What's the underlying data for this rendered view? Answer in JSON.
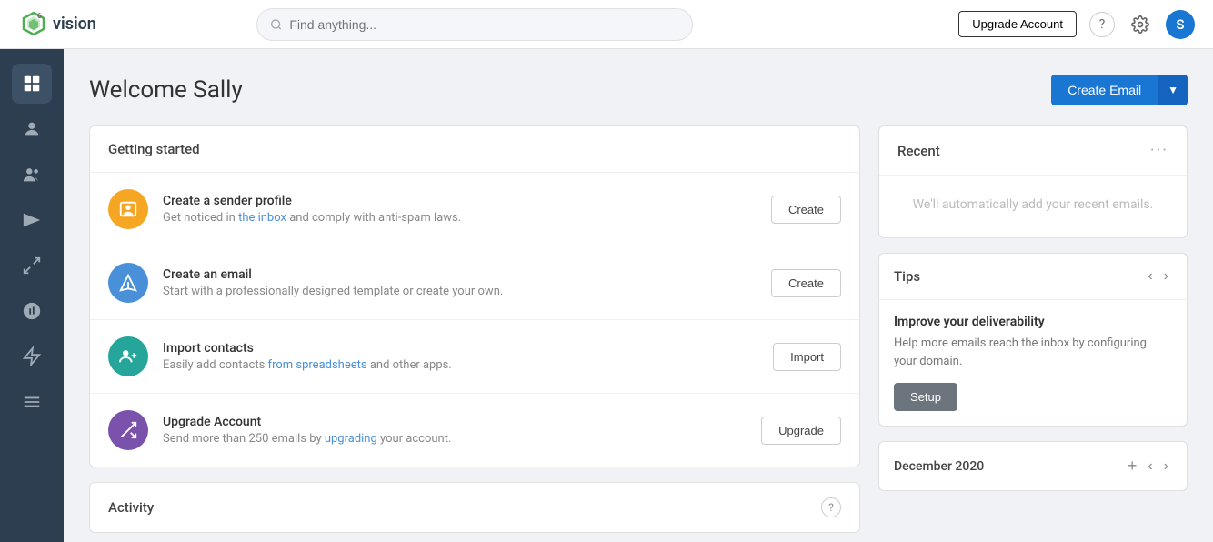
{
  "topnav": {
    "logo_text": "vision",
    "logo_superscript": "6",
    "search_placeholder": "Find anything...",
    "upgrade_btn_label": "Upgrade Account",
    "help_icon": "?",
    "user_initial": "S"
  },
  "sidebar": {
    "items": [
      {
        "id": "dashboard",
        "label": "Dashboard",
        "active": true
      },
      {
        "id": "contacts-single",
        "label": "Profile"
      },
      {
        "id": "contacts",
        "label": "Contacts"
      },
      {
        "id": "campaigns",
        "label": "Campaigns"
      },
      {
        "id": "split",
        "label": "Split"
      },
      {
        "id": "reports",
        "label": "Reports"
      },
      {
        "id": "automations",
        "label": "Automations"
      },
      {
        "id": "files",
        "label": "Files"
      }
    ]
  },
  "main": {
    "page_title": "Welcome Sally",
    "create_email_label": "Create Email",
    "create_email_dropdown_label": "▼"
  },
  "getting_started": {
    "title": "Getting started",
    "tasks": [
      {
        "id": "sender-profile",
        "title": "Create a sender profile",
        "desc_plain": "Get noticed in ",
        "desc_link": "the inbox",
        "desc_rest": " and comply with anti-spam laws.",
        "icon_color": "orange",
        "btn_label": "Create"
      },
      {
        "id": "create-email",
        "title": "Create an email",
        "desc": "Start with a professionally designed template or create your own.",
        "icon_color": "blue",
        "btn_label": "Create"
      },
      {
        "id": "import-contacts",
        "title": "Import contacts",
        "desc_plain": "Easily add contacts ",
        "desc_link": "from spreadsheets",
        "desc_rest": " and other apps.",
        "icon_color": "teal",
        "btn_label": "Import"
      },
      {
        "id": "upgrade-account",
        "title": "Upgrade Account",
        "desc_plain": "Send more than 250 emails by ",
        "desc_link": "upgrading",
        "desc_rest": " your account.",
        "icon_color": "purple",
        "btn_label": "Upgrade"
      }
    ]
  },
  "activity": {
    "title": "Activity"
  },
  "recent": {
    "title": "Recent",
    "empty_text": "We'll automatically add your recent emails.",
    "more_icon": "..."
  },
  "tips": {
    "title": "Tips",
    "card_title": "Improve your deliverability",
    "card_desc_part1": "Help more emails reach the inbox by configuring",
    "card_desc_part2": " your domain.",
    "setup_btn_label": "Setup"
  },
  "december": {
    "title": "December 2020"
  }
}
